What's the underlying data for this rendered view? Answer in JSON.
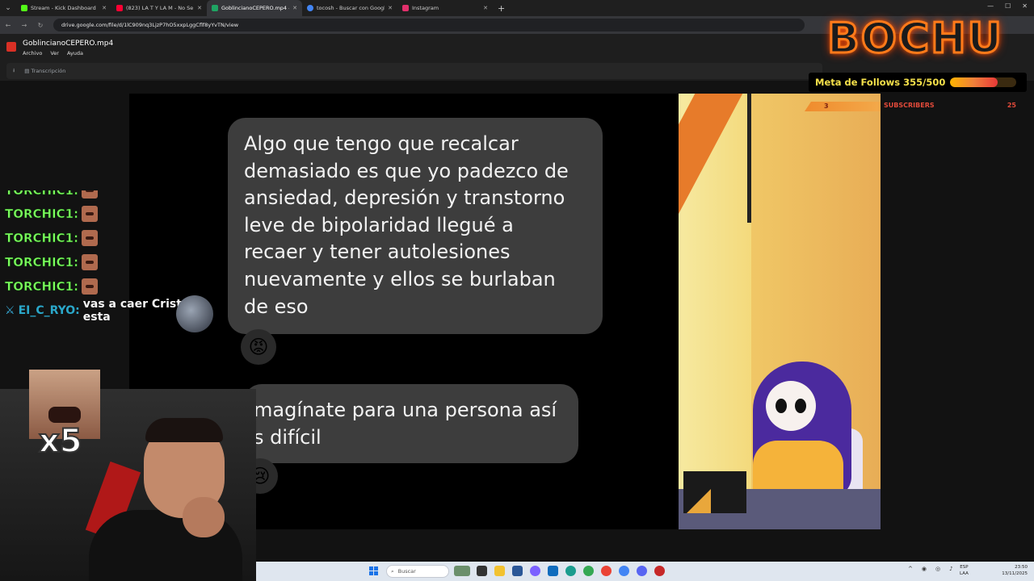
{
  "browser": {
    "tabs": [
      {
        "label": "Stream - Kick Dashboard",
        "color": "#53fc18"
      },
      {
        "label": "(823) LA T Y LA M - No Se Va",
        "color": "#ff0033"
      },
      {
        "label": "GoblincianoCEPERO.mp4 - Goo",
        "color": "#1fa463"
      },
      {
        "label": "tocosh - Buscar con Google",
        "color": "#4285f4"
      },
      {
        "label": "Instagram",
        "color": "#e1306c"
      }
    ],
    "active_tab": 2,
    "new_tab": "+",
    "url": "drive.google.com/file/d/1lC909nq3LjzP7hO5xxpLggCflf8yYvTN/view"
  },
  "drive": {
    "file_title": "GoblincianoCEPERO.mp4",
    "menu": [
      "Archivo",
      "Ver",
      "Ayuda"
    ],
    "tools": [
      "Transcripción"
    ]
  },
  "video": {
    "message1": [
      "Algo que tengo que recalcar",
      "demasiado es que yo padezco de",
      "ansiedad, depresión y transtorno",
      "leve de bipolaridad llegué a",
      "recaer y tener autolesiones",
      "nuevamente y ellos se burlaban",
      "de eso"
    ],
    "reaction1": "😡",
    "message2": [
      "magínate para una persona así",
      "s difícil"
    ],
    "reaction2": "😢"
  },
  "overlay": {
    "logo_text": "BOCHU",
    "follow_goal_label": "Meta de Follows",
    "follow_goal_value": "355/500",
    "follow_goal_progress": 0.71,
    "subscribers_label": "SUBSCRIBERS",
    "subscribers_count": "25",
    "subscribers_current": "3"
  },
  "chat": {
    "partial_line": "TORCHIC1:",
    "lines": [
      {
        "user": "TORCHIC1:"
      },
      {
        "user": "TORCHIC1:"
      },
      {
        "user": "TORCHIC1:"
      },
      {
        "user": "TORCHIC1:"
      }
    ],
    "last_user": "EI_C_RYO:",
    "last_message": "vas a caer Cristo esta"
  },
  "webcam": {
    "multiplier": "x5"
  },
  "taskbar": {
    "search_placeholder": "Buscar",
    "lang_1": "ESP",
    "lang_2": "LAA",
    "time": "23:50",
    "date": "13/11/2025"
  },
  "colors": {
    "chat_name": "#7dff5e",
    "chat_user2": "#2aa7c9",
    "goal_text": "#f4e04a",
    "subs_text": "#e24a3a",
    "logo_glow": "#ff7a1a"
  }
}
